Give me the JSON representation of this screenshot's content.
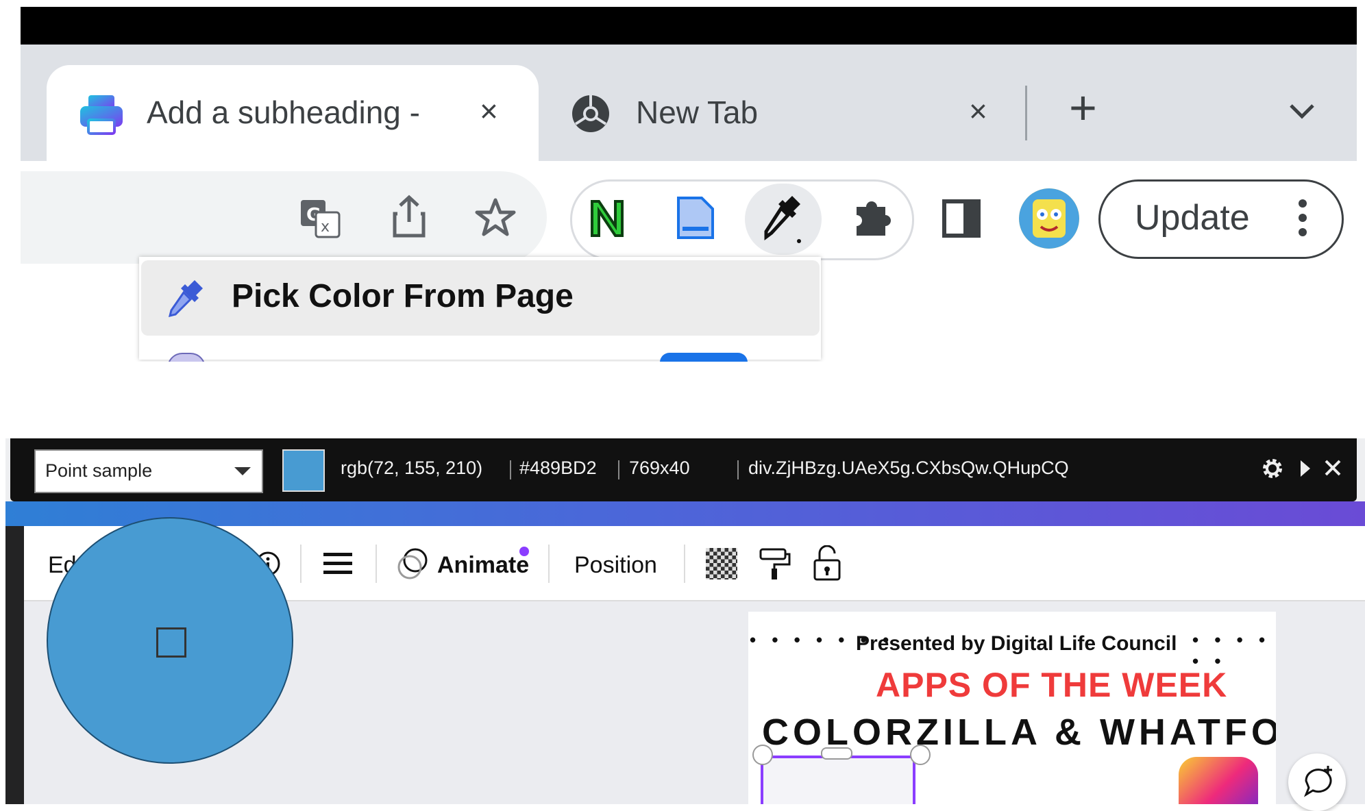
{
  "browser": {
    "tabs": [
      {
        "title": "Add a subheading -",
        "active": true,
        "icon": "canva-print-icon"
      },
      {
        "title": "New Tab",
        "active": false,
        "icon": "chrome-icon"
      }
    ],
    "new_tab_symbol": "+",
    "close_symbol": "×",
    "update_label": "Update",
    "extension_menu": {
      "items": [
        {
          "label": "Pick Color From Page",
          "icon": "eyedropper-icon"
        }
      ]
    }
  },
  "colorzilla": {
    "sample_mode": "Point sample",
    "rgb": "rgb(72, 155, 210)",
    "hex": "#489BD2",
    "size": "769x40",
    "selector": "div.ZjHBzg.UAeX5g.CXbsQw.QHupCQ",
    "picked_color": "#489BD2"
  },
  "canva": {
    "toolbar": {
      "edit_label": "Ed",
      "animate_label": "Animate",
      "position_label": "Position"
    },
    "design": {
      "presented": "Presented by Digital Life Council",
      "headline": "APPS OF THE WEEK",
      "title": "COLORZILLA & WHATFONT"
    }
  }
}
